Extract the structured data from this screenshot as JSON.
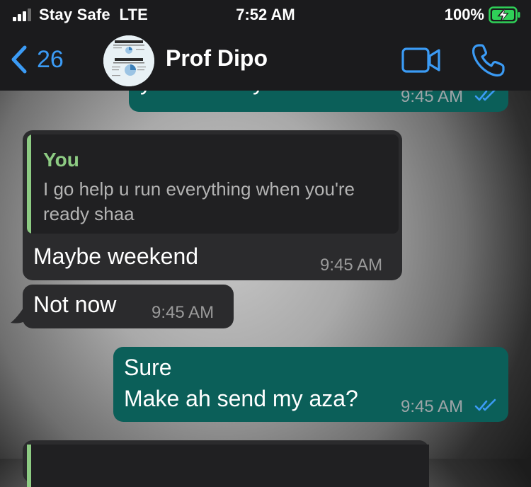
{
  "status_bar": {
    "carrier": "Stay Safe  LTE",
    "time": "7:52 AM",
    "battery": "100%"
  },
  "nav": {
    "back_count": "26",
    "contact_name": "Prof Dipo"
  },
  "colors": {
    "accent": "#3b9bf5",
    "outgoing_bubble": "#0b5f59",
    "incoming_bubble": "#2b2b2d",
    "quote_accent": "#8dcb83",
    "header_bg": "#1b1b1d"
  },
  "messages": [
    {
      "direction": "outgoing",
      "text": "you're ready shaa",
      "time": "9:45 AM",
      "read": true
    },
    {
      "direction": "incoming",
      "quote_author": "You",
      "quote_text": "I go help u run everything when you're\nready shaa",
      "text": "Maybe weekend",
      "time": "9:45 AM"
    },
    {
      "direction": "incoming",
      "text": "Not now",
      "time": "9:45 AM"
    },
    {
      "direction": "outgoing",
      "lines": [
        "Sure",
        "Make ah send my aza?"
      ],
      "time": "9:45 AM",
      "read": true
    }
  ]
}
